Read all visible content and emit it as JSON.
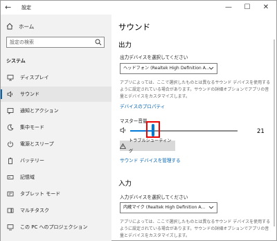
{
  "window": {
    "title": "設定"
  },
  "sidebar": {
    "home_label": "ホーム",
    "search_placeholder": "設定の検索",
    "section_title": "システム",
    "items": [
      {
        "label": "ディスプレイ",
        "icon": "monitor-icon"
      },
      {
        "label": "サウンド",
        "icon": "speaker-icon",
        "active": true
      },
      {
        "label": "通知とアクション",
        "icon": "notification-icon"
      },
      {
        "label": "集中モード",
        "icon": "moon-icon"
      },
      {
        "label": "電源とスリープ",
        "icon": "power-icon"
      },
      {
        "label": "バッテリー",
        "icon": "battery-icon"
      },
      {
        "label": "記憶域",
        "icon": "storage-icon"
      },
      {
        "label": "タブレット モード",
        "icon": "tablet-icon"
      },
      {
        "label": "マルチタスク",
        "icon": "multitask-icon"
      },
      {
        "label": "この PC へのプロジェクション",
        "icon": "projection-icon"
      }
    ]
  },
  "content": {
    "title": "サウンド",
    "output": {
      "heading": "出力",
      "device_label": "出力デバイスを選択してください",
      "device_value": "ヘッドフォン (Realtek High Definition A...",
      "note": "アプリによっては、ここで選択したものとは異なるサウンド デバイスを使用するように設定されている場合があります。サウンドの詳細オプションでアプリの音量とデバイスをカスタマイズします。",
      "properties_link": "デバイスのプロパティ",
      "master_volume_label": "マスター音量",
      "master_volume": 21,
      "troubleshoot_label": "トラブルシューティング",
      "manage_link": "サウンド デバイスを管理する"
    },
    "input": {
      "heading": "入力",
      "device_label": "入力デバイスを選択してください",
      "device_value": "内蔵マイク (Realtek High Definition A...",
      "note": "アプリによっては、ここで選択したものとは異なるサウンド デバイスを使用するように設定されている場合があります。サウンドの詳細オプションでアプリの音量とデバイスをカスタマイズします。"
    }
  },
  "colors": {
    "accent": "#0078d7",
    "link": "#0063b1",
    "highlight": "#ff0000",
    "sidebar_bg": "#f2f2f2"
  }
}
